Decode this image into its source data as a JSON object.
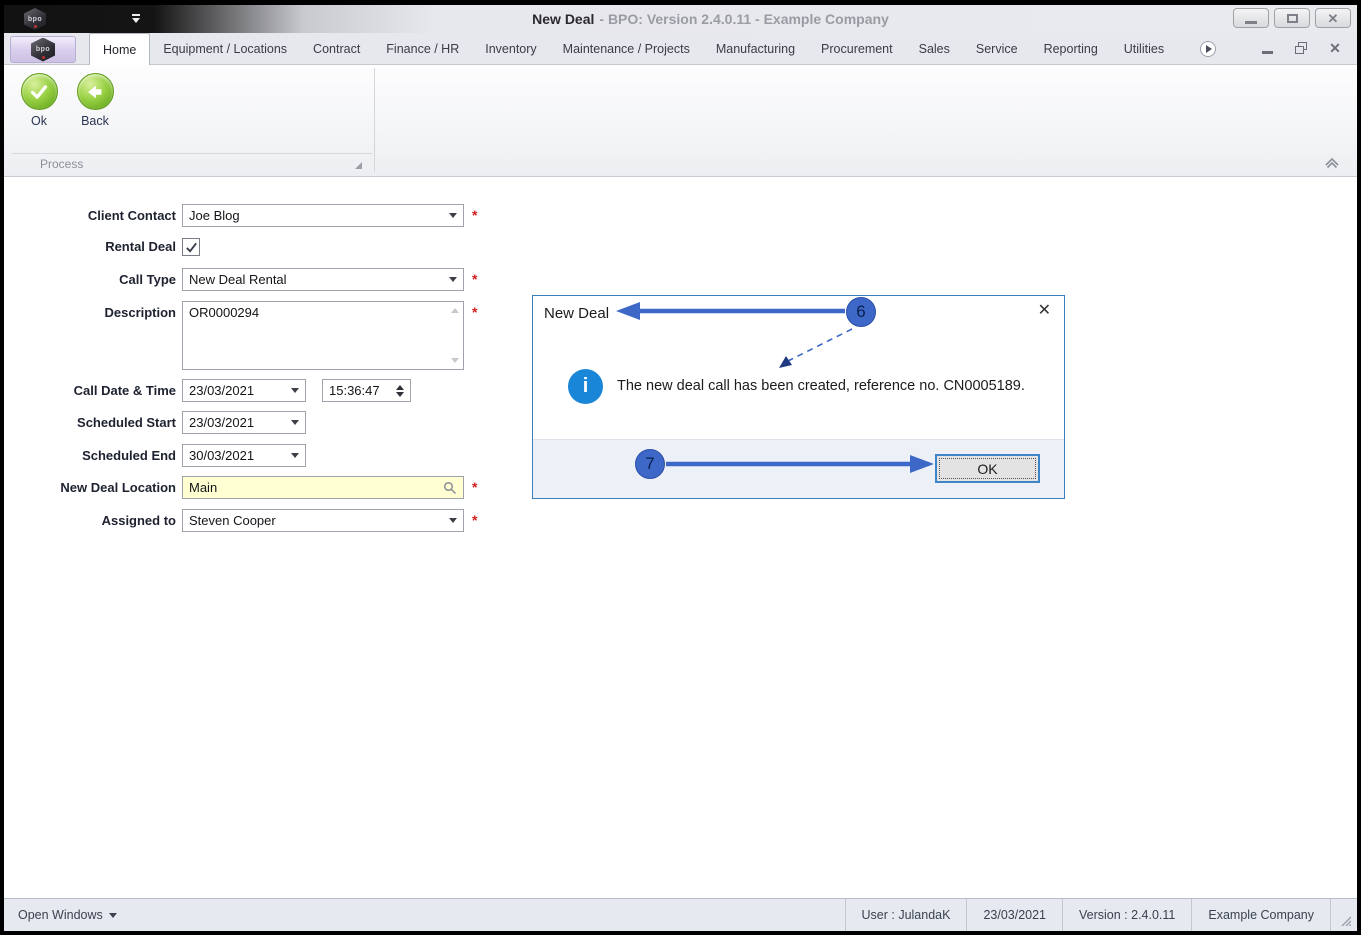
{
  "titlebar": {
    "title_main": "New Deal",
    "title_rest": "- BPO: Version 2.4.0.11 - Example Company",
    "logo_text": "bpo"
  },
  "icons": {
    "close_x": "✕",
    "info_i": "i"
  },
  "tabs": [
    "Home",
    "Equipment / Locations",
    "Contract",
    "Finance / HR",
    "Inventory",
    "Maintenance / Projects",
    "Manufacturing",
    "Procurement",
    "Sales",
    "Service",
    "Reporting",
    "Utilities"
  ],
  "active_tab": "Home",
  "ribbon": {
    "ok_label": "Ok",
    "back_label": "Back",
    "group_label": "Process"
  },
  "form": {
    "client_contact": {
      "label": "Client Contact",
      "value": "Joe Blog",
      "required": true
    },
    "rental_deal": {
      "label": "Rental Deal",
      "checked": true
    },
    "call_type": {
      "label": "Call Type",
      "value": "New Deal Rental",
      "required": true
    },
    "description": {
      "label": "Description",
      "value": "OR0000294",
      "required": true
    },
    "call_date_time": {
      "label": "Call Date & Time",
      "date": "23/03/2021",
      "time": "15:36:47"
    },
    "scheduled_start": {
      "label": "Scheduled Start",
      "date": "23/03/2021"
    },
    "scheduled_end": {
      "label": "Scheduled End",
      "date": "30/03/2021"
    },
    "new_deal_location": {
      "label": "New Deal Location",
      "value": "Main",
      "required": true
    },
    "assigned_to": {
      "label": "Assigned to",
      "value": "Steven Cooper",
      "required": true
    },
    "required_marker": "*"
  },
  "dialog": {
    "title": "New Deal",
    "message": "The new deal call has been created, reference no. CN0005189.",
    "ok_label": "OK"
  },
  "annotations": {
    "step6": "6",
    "step7": "7"
  },
  "statusbar": {
    "open_windows": "Open Windows",
    "user": "User : JulandaK",
    "date": "23/03/2021",
    "version": "Version : 2.4.0.11",
    "company": "Example Company"
  },
  "colors": {
    "annotation_blue": "#3e68c8",
    "dialog_border": "#3c7fc0",
    "info_icon_blue": "#1a86d8",
    "required_red": "#d02020",
    "location_field_yellow": "#ffffd2",
    "ok_button_green": "#76b42a"
  }
}
